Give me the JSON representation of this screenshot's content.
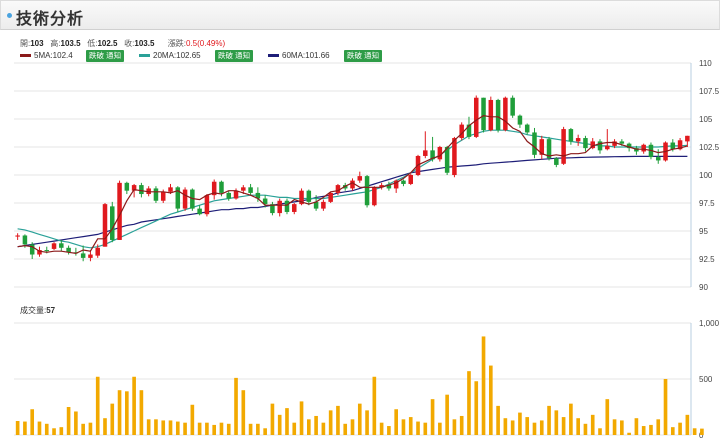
{
  "header": {
    "title": "技術分析"
  },
  "quote": {
    "open_label": "開:",
    "open": "103",
    "high_label": "高:",
    "high": "103.5",
    "low_label": "低:",
    "low": "102.5",
    "close_label": "收:",
    "close": "103.5",
    "change_label": "漲跌:",
    "change": "0.5(0.49%)"
  },
  "ma": [
    {
      "label": "5MA:102.4",
      "color": "#8b1a1a",
      "button": "跌破 通知"
    },
    {
      "label": "20MA:102.65",
      "color": "#2aa198",
      "button": "跌破 通知"
    },
    {
      "label": "60MA:101.66",
      "color": "#1e1e78",
      "button": "跌破 通知"
    }
  ],
  "volume": {
    "label": "成交量:",
    "value": "57"
  },
  "colors": {
    "up": "#e0191e",
    "down": "#1f9e3a",
    "volume": "#f2a900",
    "ma5": "#8b1a1a",
    "ma20": "#2aa198",
    "ma60": "#1e1e78"
  },
  "chart_data": {
    "type": "candlestick",
    "price_axis": {
      "ticks": [
        "110",
        "107.5",
        "105",
        "102.5",
        "100",
        "97.5",
        "95",
        "92.5",
        "90"
      ],
      "ylim": [
        90,
        110
      ]
    },
    "volume_axis": {
      "ticks": [
        "1,000",
        "500",
        "0"
      ],
      "ylim": [
        0,
        1000
      ]
    },
    "candles": [
      [
        94.5,
        94.8,
        94.2,
        94.6
      ],
      [
        94.6,
        94.7,
        93.5,
        93.8
      ],
      [
        93.8,
        94.0,
        92.5,
        92.9
      ],
      [
        92.9,
        93.6,
        92.7,
        93.3
      ],
      [
        93.3,
        93.6,
        93.0,
        93.2
      ],
      [
        93.4,
        94.0,
        93.3,
        93.9
      ],
      [
        93.9,
        94.2,
        93.2,
        93.5
      ],
      [
        93.5,
        93.7,
        92.9,
        93.1
      ],
      [
        93.1,
        93.5,
        92.8,
        93.0
      ],
      [
        93.0,
        93.7,
        92.3,
        92.6
      ],
      [
        92.6,
        93.3,
        92.3,
        92.9
      ],
      [
        92.8,
        93.8,
        92.6,
        93.5
      ],
      [
        93.6,
        97.5,
        93.6,
        97.4
      ],
      [
        97.2,
        97.6,
        94.0,
        94.2
      ],
      [
        94.2,
        99.5,
        94.2,
        99.3
      ],
      [
        99.3,
        99.4,
        98.3,
        98.6
      ],
      [
        98.6,
        99.2,
        98.0,
        99.1
      ],
      [
        99.1,
        99.3,
        98.0,
        98.3
      ],
      [
        98.3,
        99.0,
        98.1,
        98.8
      ],
      [
        98.8,
        99.0,
        97.5,
        97.7
      ],
      [
        97.7,
        98.7,
        97.5,
        98.5
      ],
      [
        98.5,
        99.2,
        98.3,
        98.9
      ],
      [
        98.9,
        99.0,
        96.7,
        97.0
      ],
      [
        97.0,
        98.9,
        96.8,
        98.7
      ],
      [
        98.7,
        98.8,
        96.8,
        97.0
      ],
      [
        97.0,
        97.3,
        96.4,
        96.5
      ],
      [
        96.5,
        98.3,
        96.3,
        98.2
      ],
      [
        98.2,
        99.6,
        97.8,
        99.4
      ],
      [
        99.4,
        99.5,
        98.1,
        98.4
      ],
      [
        98.4,
        98.6,
        97.7,
        97.9
      ],
      [
        97.9,
        98.8,
        97.8,
        98.6
      ],
      [
        98.6,
        99.1,
        98.3,
        98.9
      ],
      [
        98.9,
        99.2,
        98.2,
        98.4
      ],
      [
        98.4,
        98.9,
        97.6,
        97.9
      ],
      [
        97.9,
        98.2,
        97.1,
        97.4
      ],
      [
        97.4,
        97.6,
        96.4,
        96.6
      ],
      [
        96.6,
        97.9,
        96.3,
        97.7
      ],
      [
        97.7,
        97.9,
        96.5,
        96.7
      ],
      [
        96.7,
        97.5,
        96.5,
        97.4
      ],
      [
        97.4,
        98.8,
        97.3,
        98.6
      ],
      [
        98.6,
        98.7,
        97.3,
        97.6
      ],
      [
        97.6,
        98.2,
        96.8,
        97.0
      ],
      [
        97.0,
        97.8,
        96.8,
        97.6
      ],
      [
        97.6,
        98.5,
        97.5,
        98.4
      ],
      [
        98.4,
        99.2,
        98.2,
        99.1
      ],
      [
        99.1,
        99.3,
        98.6,
        98.8
      ],
      [
        98.8,
        99.7,
        98.6,
        99.5
      ],
      [
        99.5,
        100.3,
        99.3,
        99.9
      ],
      [
        99.9,
        100.0,
        97.1,
        97.3
      ],
      [
        97.3,
        99.0,
        97.2,
        98.9
      ],
      [
        98.9,
        99.3,
        98.7,
        99.1
      ],
      [
        99.1,
        99.4,
        98.6,
        98.8
      ],
      [
        98.8,
        99.6,
        98.4,
        99.5
      ],
      [
        99.5,
        99.6,
        99.0,
        99.2
      ],
      [
        99.2,
        100.1,
        99.1,
        100.0
      ],
      [
        100.0,
        101.8,
        99.9,
        101.7
      ],
      [
        101.7,
        103.9,
        101.5,
        102.2
      ],
      [
        102.2,
        103.4,
        101.2,
        101.4
      ],
      [
        101.4,
        102.6,
        101.2,
        102.5
      ],
      [
        102.5,
        102.6,
        100.0,
        100.2
      ],
      [
        100.0,
        103.4,
        99.8,
        103.3
      ],
      [
        103.3,
        104.7,
        103.1,
        104.5
      ],
      [
        104.5,
        105.2,
        103.2,
        103.4
      ],
      [
        103.4,
        107.1,
        103.3,
        106.9
      ],
      [
        106.9,
        106.9,
        103.8,
        104.0
      ],
      [
        104.0,
        107.0,
        103.9,
        106.7
      ],
      [
        106.7,
        106.8,
        103.8,
        104.0
      ],
      [
        104.0,
        107.0,
        103.9,
        106.9
      ],
      [
        106.9,
        107.1,
        105.1,
        105.3
      ],
      [
        105.3,
        105.4,
        104.2,
        104.5
      ],
      [
        104.5,
        104.6,
        103.6,
        103.8
      ],
      [
        103.8,
        104.2,
        101.5,
        101.8
      ],
      [
        101.8,
        103.5,
        101.4,
        103.2
      ],
      [
        103.2,
        103.4,
        101.3,
        101.5
      ],
      [
        101.5,
        101.6,
        100.7,
        100.9
      ],
      [
        101.0,
        104.3,
        100.9,
        104.1
      ],
      [
        104.1,
        104.2,
        102.7,
        103.0
      ],
      [
        103.0,
        103.6,
        102.6,
        103.3
      ],
      [
        103.3,
        103.5,
        102.1,
        102.4
      ],
      [
        102.4,
        103.3,
        102.3,
        103.0
      ],
      [
        103.0,
        103.2,
        101.9,
        102.2
      ],
      [
        102.3,
        104.1,
        102.2,
        102.6
      ],
      [
        102.6,
        103.2,
        102.4,
        103.0
      ],
      [
        103.0,
        103.2,
        102.6,
        102.8
      ],
      [
        102.8,
        102.9,
        102.1,
        102.4
      ],
      [
        102.4,
        102.6,
        101.8,
        102.1
      ],
      [
        102.1,
        102.8,
        101.9,
        102.7
      ],
      [
        102.7,
        102.9,
        101.4,
        101.6
      ],
      [
        101.6,
        102.3,
        101.0,
        101.3
      ],
      [
        101.3,
        103.0,
        101.2,
        102.9
      ],
      [
        102.9,
        103.2,
        102.1,
        102.3
      ],
      [
        102.3,
        103.3,
        102.2,
        103.1
      ],
      [
        103.0,
        103.5,
        102.5,
        103.5
      ]
    ],
    "volumes": [
      125,
      120,
      230,
      120,
      100,
      60,
      70,
      250,
      210,
      100,
      110,
      520,
      150,
      280,
      400,
      390,
      520,
      400,
      140,
      140,
      130,
      130,
      120,
      110,
      270,
      110,
      110,
      90,
      110,
      100,
      510,
      400,
      100,
      100,
      60,
      280,
      180,
      240,
      110,
      300,
      140,
      170,
      110,
      220,
      260,
      100,
      140,
      280,
      220,
      520,
      110,
      80,
      230,
      140,
      160,
      120,
      110,
      320,
      110,
      360,
      140,
      170,
      570,
      480,
      880,
      620,
      260,
      150,
      130,
      200,
      160,
      110,
      130,
      260,
      220,
      160,
      280,
      150,
      100,
      180,
      60,
      320,
      140,
      130,
      20,
      150,
      80,
      90,
      140,
      500,
      70,
      110,
      180,
      60,
      57
    ],
    "ma5": [
      93.6,
      93.7,
      93.6,
      93.2,
      93.1,
      93.2,
      93.2,
      93.1,
      93.0,
      93.3,
      93.2,
      94.3,
      94.3,
      95.2,
      96.4,
      97.7,
      98.7,
      98.6,
      98.5,
      98.5,
      98.5,
      98.4,
      98.6,
      98.2,
      97.9,
      97.8,
      98.2,
      98.4,
      98.3,
      98.6,
      98.6,
      98.4,
      98.2,
      97.9,
      97.3,
      97.3,
      97.3,
      97.3,
      97.8,
      97.6,
      97.4,
      97.6,
      98.0,
      98.5,
      98.6,
      99.0,
      99.3,
      98.9,
      98.9,
      98.9,
      98.9,
      99.1,
      99.3,
      99.7,
      100.2,
      100.9,
      101.2,
      101.5,
      101.7,
      102.4,
      103.1,
      103.7,
      104.4,
      104.9,
      105.3,
      105.2,
      105.2,
      104.8,
      104.2,
      103.9,
      103.0,
      102.5,
      101.9,
      101.7,
      101.8,
      101.7,
      101.9,
      101.9,
      102.0,
      102.6,
      102.8,
      102.9,
      102.9,
      102.7,
      102.5,
      102.3,
      102.3,
      102.2,
      102.0,
      102.1,
      102.3,
      102.4,
      102.6
    ],
    "ma20": [
      95.2,
      95.1,
      94.9,
      94.7,
      94.5,
      94.3,
      94.1,
      94.0,
      93.8,
      93.6,
      93.5,
      93.6,
      93.8,
      94.1,
      94.4,
      94.7,
      95.0,
      95.3,
      95.6,
      95.9,
      96.2,
      96.5,
      96.7,
      96.9,
      97.1,
      97.3,
      97.5,
      97.7,
      97.8,
      97.9,
      98.0,
      98.1,
      98.2,
      98.2,
      98.2,
      98.1,
      98.0,
      98.0,
      97.9,
      97.9,
      97.9,
      97.9,
      97.9,
      98.0,
      98.1,
      98.2,
      98.3,
      98.4,
      98.5,
      98.7,
      98.9,
      99.2,
      99.5,
      99.8,
      100.2,
      100.6,
      101.0,
      101.4,
      101.8,
      102.2,
      102.7,
      103.1,
      103.5,
      103.7,
      103.9,
      104.0,
      104.0,
      104.0,
      103.9,
      103.8,
      103.6,
      103.5,
      103.4,
      103.3,
      103.2,
      103.1,
      103.0,
      102.9,
      102.8,
      102.7,
      102.6,
      102.6,
      102.5,
      102.5,
      102.5,
      102.5,
      102.5,
      102.5,
      102.5,
      102.55,
      102.6,
      102.6,
      102.65
    ],
    "ma60": [
      93.6,
      93.7,
      93.8,
      93.9,
      94.0,
      94.1,
      94.2,
      94.3,
      94.4,
      94.5,
      94.6,
      94.7,
      94.9,
      95.1,
      95.3,
      95.5,
      95.6,
      95.8,
      95.9,
      96.0,
      96.1,
      96.2,
      96.3,
      96.4,
      96.5,
      96.6,
      96.7,
      96.8,
      96.9,
      96.9,
      97.0,
      97.0,
      97.1,
      97.1,
      97.2,
      97.3,
      97.4,
      97.5,
      97.6,
      97.7,
      97.8,
      98.0,
      98.1,
      98.2,
      98.4,
      98.5,
      98.6,
      98.8,
      99.0,
      99.2,
      99.4,
      99.6,
      99.8,
      100.0,
      100.2,
      100.3,
      100.4,
      100.5,
      100.6,
      100.7,
      100.75,
      100.8,
      100.85,
      100.9,
      101.0,
      101.05,
      101.1,
      101.15,
      101.2,
      101.25,
      101.3,
      101.35,
      101.4,
      101.45,
      101.5,
      101.52,
      101.54,
      101.56,
      101.58,
      101.6,
      101.61,
      101.62,
      101.63,
      101.64,
      101.65,
      101.66,
      101.66,
      101.66,
      101.66,
      101.66,
      101.66,
      101.66,
      101.66
    ]
  }
}
